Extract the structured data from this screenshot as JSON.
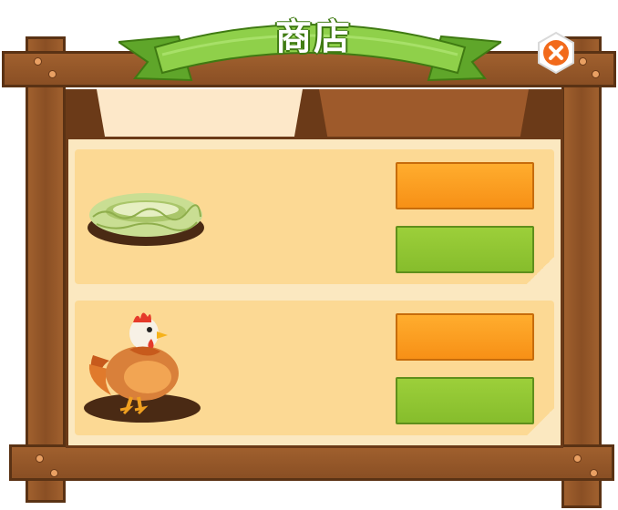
{
  "header": {
    "title": "商店"
  },
  "tabs": [
    {
      "label": "",
      "active": true
    },
    {
      "label": "",
      "active": false
    }
  ],
  "shop_items": [
    {
      "icon": "hay-nest-icon",
      "buy_label": "",
      "sell_label": ""
    },
    {
      "icon": "hen-icon",
      "buy_label": "",
      "sell_label": ""
    }
  ],
  "colors": {
    "wood": "#8a4f24",
    "wood_dark": "#5a3214",
    "ribbon_green": "#7cc23a",
    "buy_orange": "#f79016",
    "sell_green": "#86bd2c",
    "card_bg": "#fcd994",
    "close_orange": "#f26a1b"
  }
}
